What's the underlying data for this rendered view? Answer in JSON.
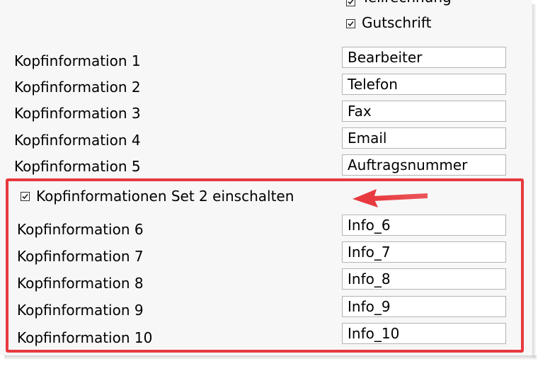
{
  "checkboxes": {
    "partial_label": "Teilrechnung",
    "gutschrift_label": "Gutschrift",
    "set2_label": "Kopfinformationen Set 2 einschalten"
  },
  "rows": [
    {
      "label": "Kopfinformation 1",
      "value": "Bearbeiter"
    },
    {
      "label": "Kopfinformation 2",
      "value": "Telefon"
    },
    {
      "label": "Kopfinformation 3",
      "value": "Fax"
    },
    {
      "label": "Kopfinformation 4",
      "value": "Email"
    },
    {
      "label": "Kopfinformation 5",
      "value": "Auftragsnummer"
    },
    {
      "label": "Kopfinformation 6",
      "value": "Info_6"
    },
    {
      "label": "Kopfinformation 7",
      "value": "Info_7"
    },
    {
      "label": "Kopfinformation 8",
      "value": "Info_8"
    },
    {
      "label": "Kopfinformation 9",
      "value": "Info_9"
    },
    {
      "label": "Kopfinformation 10",
      "value": "Info_10"
    }
  ],
  "colors": {
    "highlight": "#e8393e",
    "arrow": "#e8393e",
    "panel": "#f7f7f7"
  },
  "icons": {
    "checkbox_checked": "checkmark-icon",
    "annotation": "arrow-left-icon"
  }
}
